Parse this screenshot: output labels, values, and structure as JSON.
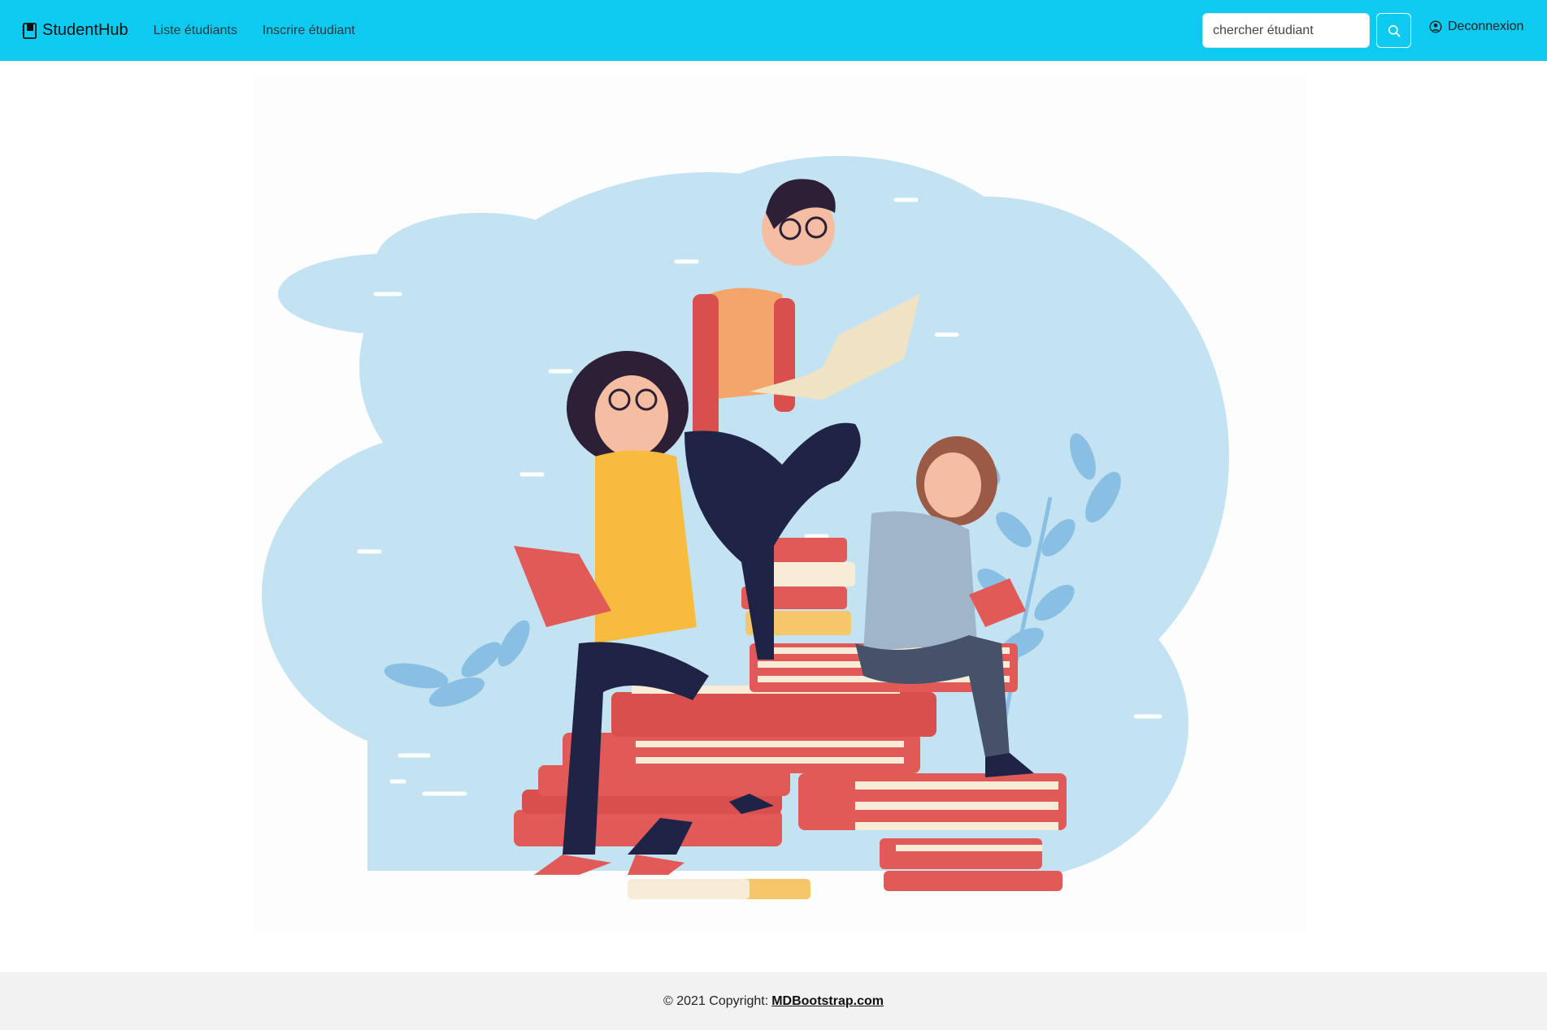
{
  "navbar": {
    "brand": "StudentHub",
    "links": [
      "Liste étudiants",
      "Inscrire étudiant"
    ],
    "search_placeholder": "chercher étudiant",
    "logout_label": "Deconnexion",
    "background": "#0dcaf0"
  },
  "hero": {
    "colors": {
      "sky": "#c4e3f2",
      "cloud_dark": "#a9d4ec",
      "leaf": "#89bfe3",
      "book_red": "#e25a57",
      "book_page": "#f6ecd8",
      "shirt_orange": "#f4a56a",
      "shirt_yellow": "#f7bb3d",
      "shirt_blue": "#9eb6c8",
      "pants_navy": "#1f2345"
    }
  },
  "footer": {
    "copyright": "© 2021 Copyright:",
    "link": "MDBootstrap.com"
  }
}
